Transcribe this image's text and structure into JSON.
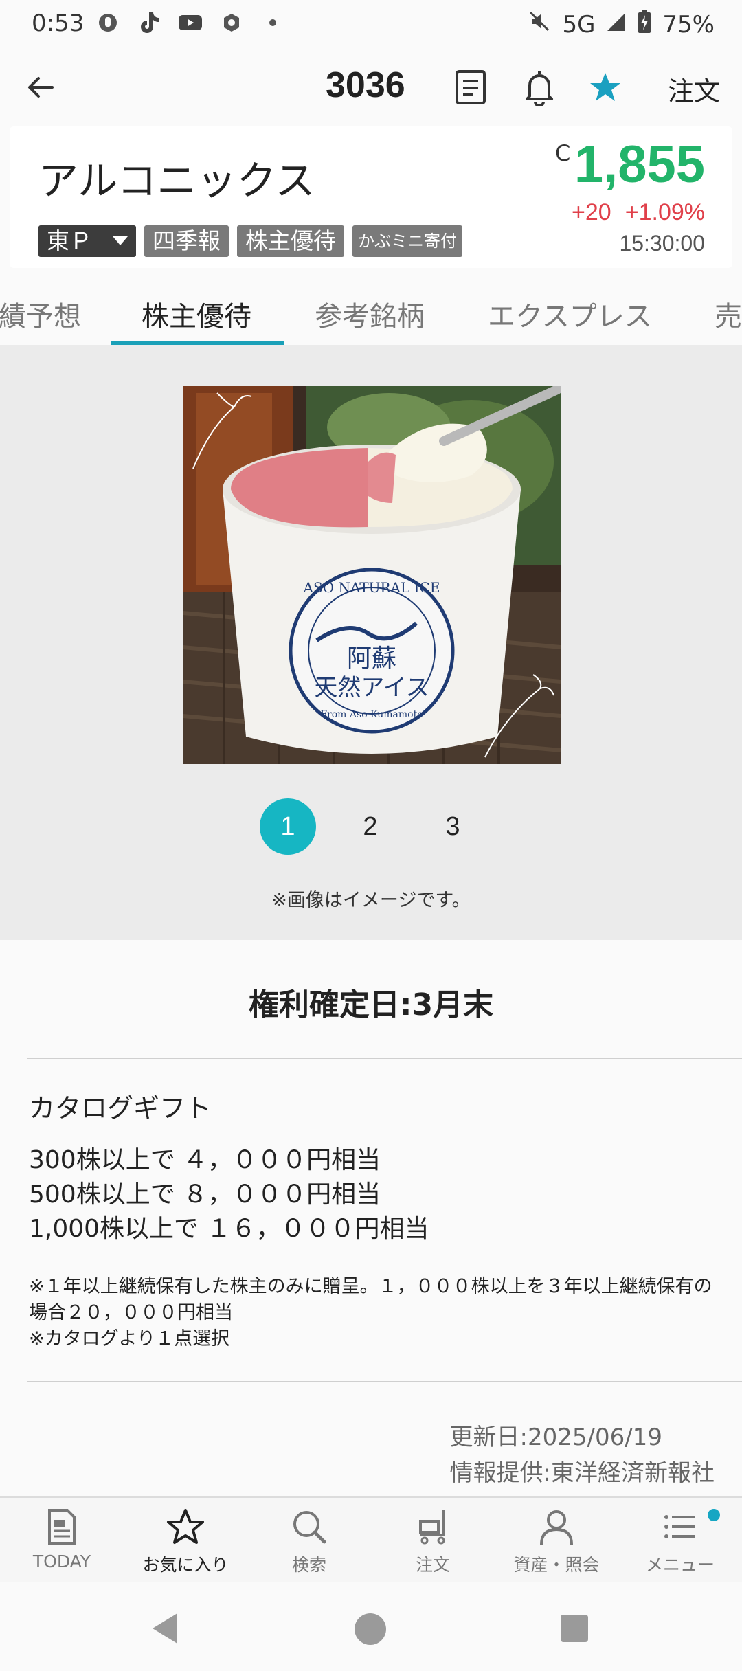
{
  "status_bar": {
    "time": "0:53",
    "network": "5G",
    "battery": "75%"
  },
  "header": {
    "stock_code": "3036",
    "order_label": "注文"
  },
  "stock": {
    "name": "アルコニックス",
    "market_tag": "東Ｐ",
    "tags": [
      "四季報",
      "株主優待",
      "かぶミニ寄付"
    ],
    "price_prefix": "C",
    "price": "1,855",
    "change": "+20",
    "change_pct": "+1.09%",
    "time": "15:30:00",
    "price_color": "#22b46a",
    "change_color": "#e0404a"
  },
  "tabs": [
    "績予想",
    "株主優待",
    "参考銘柄",
    "エクスプレス",
    "売"
  ],
  "active_tab": "株主優待",
  "gallery": {
    "pages": [
      "1",
      "2",
      "3"
    ],
    "active_page": "1",
    "note": "※画像はイメージです。",
    "cup_label_top": "ASO NATURAL ICE",
    "cup_label_main_1": "阿蘇",
    "cup_label_main_2": "天然アイス",
    "cup_label_bottom": "From Aso Kumamoto"
  },
  "detail": {
    "record_date": "権利確定日:3月末",
    "gift_title": "カタログギフト",
    "gift_lines": [
      "300株以上で ４，０００円相当",
      "500株以上で ８，０００円相当",
      "1,000株以上で １６，０００円相当"
    ],
    "notes": [
      "※１年以上継続保有した株主のみに贈呈。１，０００株以上を３年以上継続保有の場合２０，０００円相当",
      "※カタログより１点選択"
    ],
    "updated": "更新日:2025/06/19",
    "provider": "情報提供:東洋経済新報社"
  },
  "bottom_nav": [
    {
      "label": "TODAY",
      "icon": "document-icon"
    },
    {
      "label": "お気に入り",
      "icon": "star-icon"
    },
    {
      "label": "検索",
      "icon": "search-icon"
    },
    {
      "label": "注文",
      "icon": "cart-icon"
    },
    {
      "label": "資産・照会",
      "icon": "person-icon"
    },
    {
      "label": "メニュー",
      "icon": "menu-icon"
    }
  ],
  "accent_color": "#16b6c3"
}
